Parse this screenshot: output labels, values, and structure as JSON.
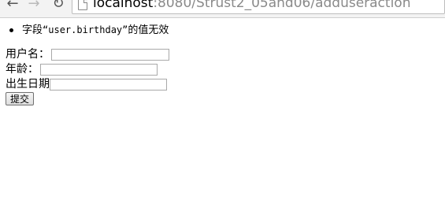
{
  "browser": {
    "url_host": "localhost",
    "url_rest": ":8080/Strust2_05and06/adduseraction",
    "icons": {
      "back": "arrow-left-icon",
      "forward": "arrow-right-icon",
      "reload": "reload-icon",
      "page": "page-icon"
    }
  },
  "page": {
    "errors": [
      {
        "prefix": "字段",
        "field": "“user.birthday”",
        "suffix": "的值无效"
      }
    ],
    "form": {
      "username_label": "用户名：",
      "username_value": "",
      "age_label": "年龄：",
      "age_value": "",
      "birthday_label": "出生日期",
      "birthday_value": "",
      "submit_label": "提交"
    }
  }
}
